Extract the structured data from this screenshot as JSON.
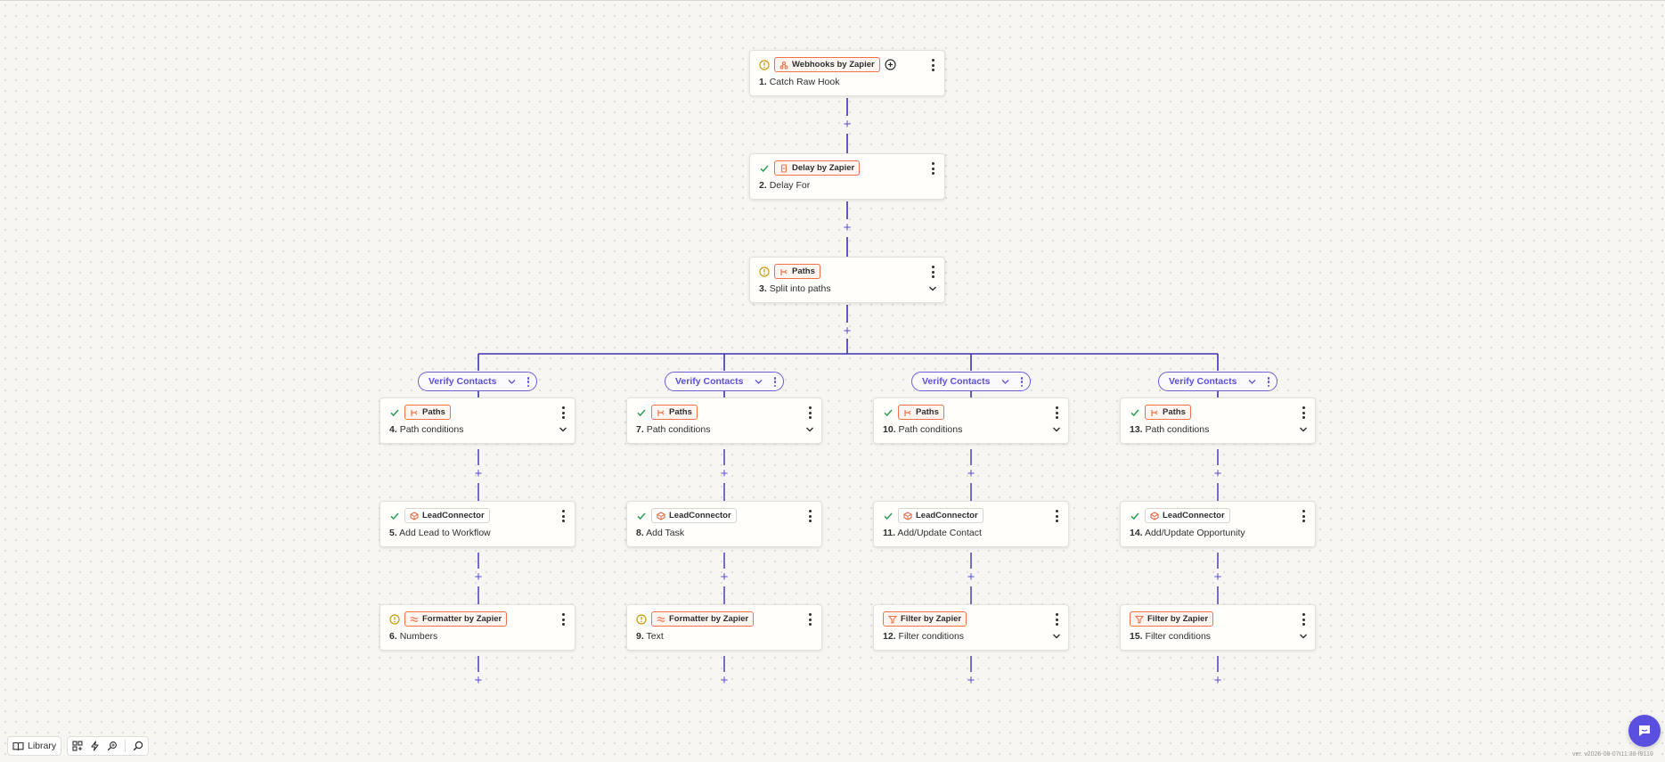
{
  "steps": {
    "s1": {
      "app": "Webhooks by Zapier",
      "num": "1.",
      "title": "Catch Raw Hook"
    },
    "s2": {
      "app": "Delay by Zapier",
      "num": "2.",
      "title": "Delay For"
    },
    "s3": {
      "app": "Paths",
      "num": "3.",
      "title": "Split into paths"
    },
    "s4": {
      "app": "Paths",
      "num": "4.",
      "title": "Path conditions"
    },
    "s5": {
      "app": "LeadConnector",
      "num": "5.",
      "title": "Add Lead to Workflow"
    },
    "s6": {
      "app": "Formatter by Zapier",
      "num": "6.",
      "title": "Numbers"
    },
    "s7": {
      "app": "Paths",
      "num": "7.",
      "title": "Path conditions"
    },
    "s8": {
      "app": "LeadConnector",
      "num": "8.",
      "title": "Add Task"
    },
    "s9": {
      "app": "Formatter by Zapier",
      "num": "9.",
      "title": "Text"
    },
    "s10": {
      "app": "Paths",
      "num": "10.",
      "title": "Path conditions"
    },
    "s11": {
      "app": "LeadConnector",
      "num": "11.",
      "title": "Add/Update Contact"
    },
    "s12": {
      "app": "Filter by Zapier",
      "num": "12.",
      "title": "Filter conditions"
    },
    "s13": {
      "app": "Paths",
      "num": "13.",
      "title": "Path conditions"
    },
    "s14": {
      "app": "LeadConnector",
      "num": "14.",
      "title": "Add/Update Opportunity"
    },
    "s15": {
      "app": "Filter by Zapier",
      "num": "15.",
      "title": "Filter conditions"
    }
  },
  "paths": {
    "p1": "Verify Contacts",
    "p2": "Verify Contacts",
    "p3": "Verify Contacts",
    "p4": "Verify Contacts"
  },
  "add_symbol": "+",
  "toolbar": {
    "library_label": "Library"
  },
  "version": "ver. v2026-08-07t11:38-f9110",
  "colors": {
    "accent": "#5b50d6",
    "app_badge_border": "#f0714a",
    "warning": "#c99a0b",
    "success": "#2e9d57"
  }
}
